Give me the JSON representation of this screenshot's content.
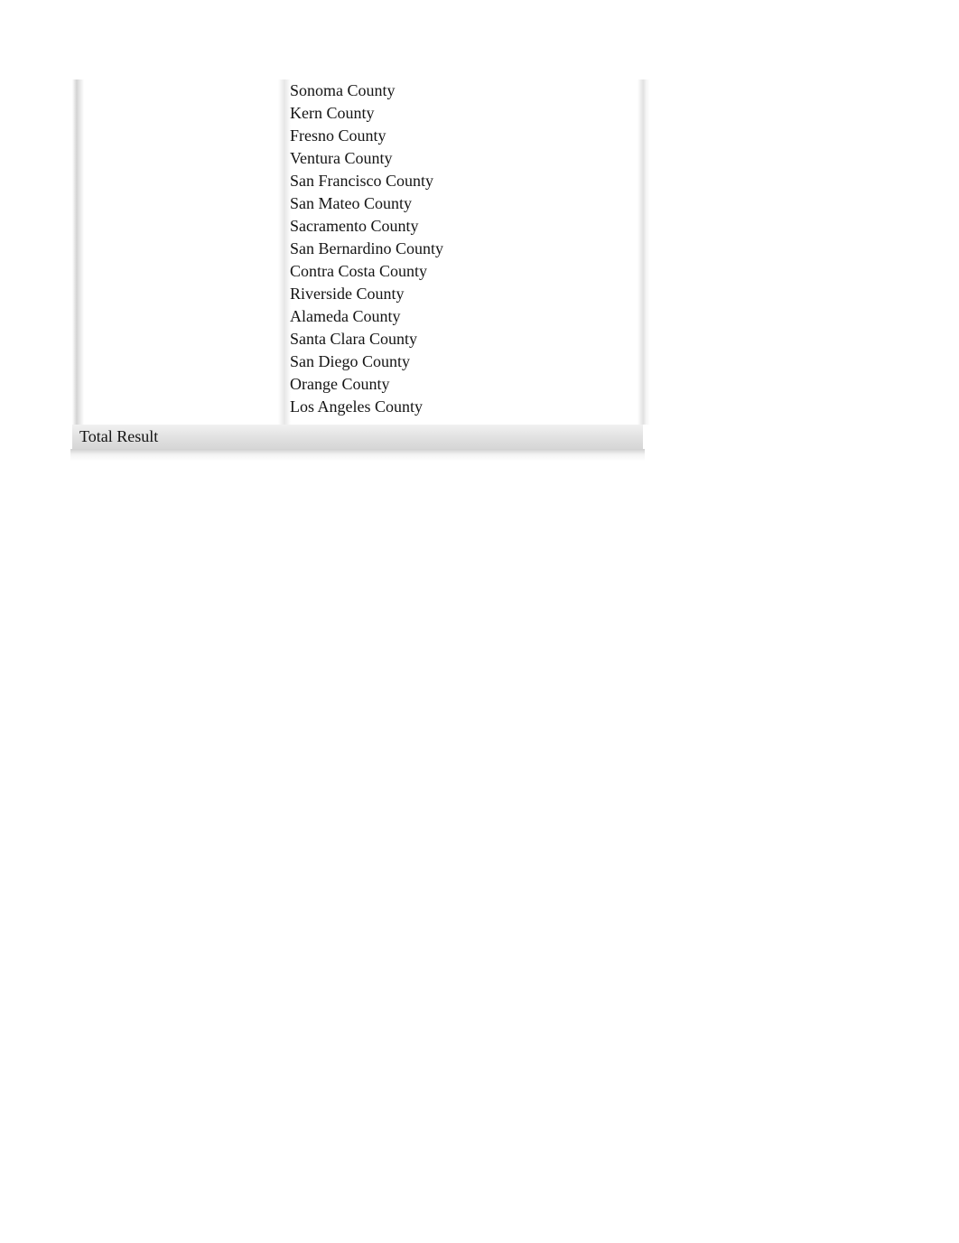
{
  "report": {
    "rows": [
      {
        "group": "",
        "label": "Sonoma County"
      },
      {
        "group": "",
        "label": "Kern County"
      },
      {
        "group": "",
        "label": "Fresno County"
      },
      {
        "group": "",
        "label": "Ventura County"
      },
      {
        "group": "",
        "label": "San Francisco County"
      },
      {
        "group": "",
        "label": "San Mateo County"
      },
      {
        "group": "",
        "label": "Sacramento County"
      },
      {
        "group": "",
        "label": "San Bernardino County"
      },
      {
        "group": "",
        "label": "Contra Costa County"
      },
      {
        "group": "",
        "label": "Riverside County"
      },
      {
        "group": "",
        "label": "Alameda County"
      },
      {
        "group": "",
        "label": "Santa Clara County"
      },
      {
        "group": "",
        "label": "San Diego County"
      },
      {
        "group": "",
        "label": "Orange County"
      },
      {
        "group": "",
        "label": "Los Angeles County"
      }
    ],
    "total_row": {
      "label": "Total Result"
    },
    "colors": {
      "text": "#141414",
      "total_row_top": "#f1f1f1",
      "total_row_bottom": "#d6d6d6",
      "rail": "#c4c4c4",
      "page_background": "#ffffff"
    }
  }
}
